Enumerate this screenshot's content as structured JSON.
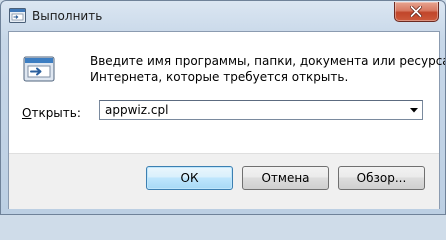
{
  "window": {
    "title": "Выполнить",
    "icon": "run-dialog-icon",
    "close_icon": "close-icon"
  },
  "dialog": {
    "icon": "run-program-icon",
    "instruction_line1": "Введите имя программы, папки, документа или ресурса",
    "instruction_line2": "Интернета, которые требуется открыть.",
    "open_label_accel": "О",
    "open_label_rest": "ткрыть:",
    "open_value": "appwiz.cpl",
    "dropdown_icon": "chevron-down-icon"
  },
  "buttons": {
    "ok": "ОК",
    "cancel": "Отмена",
    "browse": "Обзор..."
  },
  "colors": {
    "close_button": "#c8503a",
    "default_button_border": "#3c7fb1",
    "frame": "#bccfe3"
  }
}
